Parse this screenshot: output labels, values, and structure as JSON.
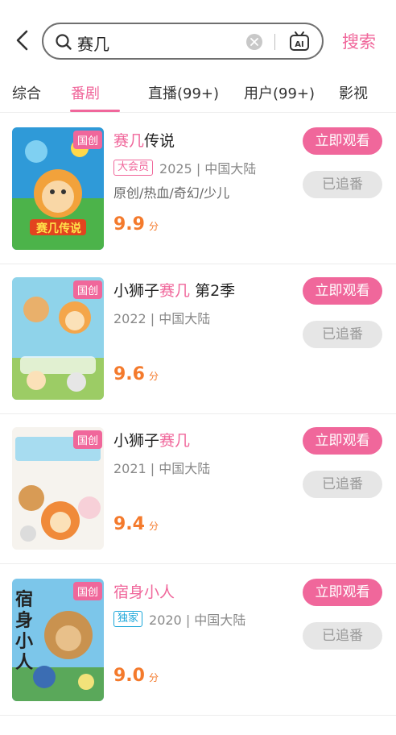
{
  "header": {
    "search_query": "赛几",
    "search_button": "搜索"
  },
  "tabs": [
    {
      "label": "综合"
    },
    {
      "label": "番剧"
    },
    {
      "label": "直播(99+)"
    },
    {
      "label": "用户(99+)"
    },
    {
      "label": "影视"
    }
  ],
  "results": [
    {
      "badge": "国创",
      "cover_title": "赛几传说",
      "title_highlight": "赛几",
      "title_rest": "传说",
      "tag": "大会员",
      "meta": "2025 | 中国大陆",
      "genre": "原创/热血/奇幻/少儿",
      "score": "9.9",
      "score_unit": "分",
      "watch_label": "立即观看",
      "follow_label": "已追番"
    },
    {
      "badge": "国创",
      "title_prefix": "小狮子",
      "title_highlight": "赛几",
      "title_rest": " 第2季",
      "meta": "2022 | 中国大陆",
      "score": "9.6",
      "score_unit": "分",
      "watch_label": "立即观看",
      "follow_label": "已追番"
    },
    {
      "badge": "国创",
      "title_prefix": "小狮子",
      "title_highlight": "赛几",
      "meta": "2021 | 中国大陆",
      "score": "9.4",
      "score_unit": "分",
      "watch_label": "立即观看",
      "follow_label": "已追番"
    },
    {
      "badge": "国创",
      "cover_title": "宿身小人",
      "title_highlight": "宿身小人",
      "tag": "独家",
      "meta": "2020 | 中国大陆",
      "score": "9.0",
      "score_unit": "分",
      "watch_label": "立即观看",
      "follow_label": "已追番"
    }
  ],
  "colors": {
    "accent": "#f0679b",
    "score": "#f47a2c",
    "exclusive": "#19a6d9"
  }
}
